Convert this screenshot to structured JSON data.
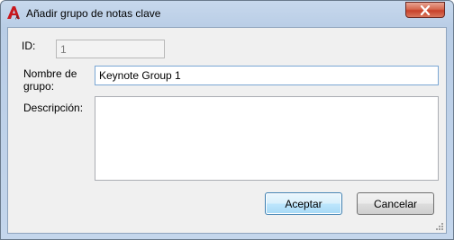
{
  "window": {
    "title": "Añadir grupo de notas clave"
  },
  "form": {
    "id_label": "ID:",
    "id_value": "1",
    "name_label_line1": "Nombre de",
    "name_label_line2": "grupo:",
    "name_value": "Keynote Group 1",
    "description_label": "Descripción:",
    "description_value": ""
  },
  "buttons": {
    "accept": "Aceptar",
    "cancel": "Cancelar"
  },
  "colors": {
    "app_icon": "#c8181e",
    "close_button": "#c7412a",
    "default_button_border": "#3c7fb1"
  },
  "icons": {
    "app": "autocad-a-icon",
    "close": "close-icon",
    "grip": "resize-grip-icon"
  }
}
